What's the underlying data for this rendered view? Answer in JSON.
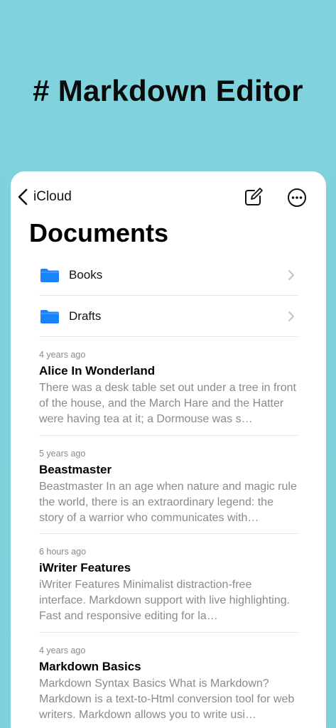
{
  "hero": {
    "title": "# Markdown Editor"
  },
  "navbar": {
    "back_label": "iCloud",
    "icons": {
      "back": "chevron-left-icon",
      "compose": "compose-icon",
      "more": "ellipsis-circle-icon"
    }
  },
  "page": {
    "title": "Documents"
  },
  "folders": [
    {
      "name": "Books"
    },
    {
      "name": "Drafts"
    }
  ],
  "documents": [
    {
      "date": "4 years ago",
      "title": "Alice In Wonderland",
      "preview": "There was a desk table set out under a tree in front of the house, and the March Hare and the Hatter were having tea at it; a Dormouse was s…"
    },
    {
      "date": "5 years ago",
      "title": "Beastmaster",
      "preview": "Beastmaster In an age when nature and magic rule the world, there is an extraordinary legend: the story of a warrior who communicates with…"
    },
    {
      "date": "6 hours ago",
      "title": "iWriter Features",
      "preview": "iWriter Features Minimalist distraction-free interface. Markdown support with live highlighting. Fast and responsive editing for la…"
    },
    {
      "date": "4 years ago",
      "title": "Markdown Basics",
      "preview": "Markdown Syntax Basics What is Markdown? Markdown is a text-to-Html conversion tool for web writers. Markdown allows you to write usi…"
    }
  ],
  "colors": {
    "background": "#80d3dc",
    "folder": "#1a82fb",
    "secondary_text": "#8a8a8e"
  }
}
